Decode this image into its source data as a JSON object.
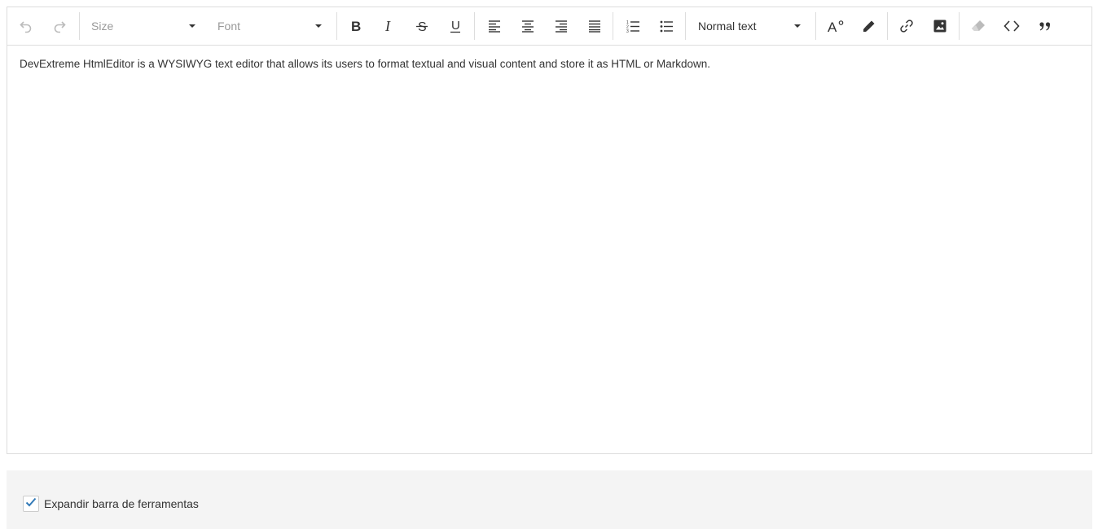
{
  "toolbar": {
    "undo_icon": "undo-icon",
    "redo_icon": "redo-icon",
    "size_placeholder": "Size",
    "font_placeholder": "Font",
    "bold_icon": "bold-icon",
    "italic_icon": "italic-icon",
    "strike_icon": "strikethrough-icon",
    "underline_icon": "underline-icon",
    "align_left_icon": "align-left-icon",
    "align_center_icon": "align-center-icon",
    "align_right_icon": "align-right-icon",
    "align_justify_icon": "align-justify-icon",
    "ordered_list_icon": "ordered-list-icon",
    "bullet_list_icon": "bullet-list-icon",
    "header_value": "Normal text",
    "color_icon": "font-color-icon",
    "background_icon": "background-color-icon",
    "link_icon": "link-icon",
    "image_icon": "image-icon",
    "clear_icon": "clear-format-icon",
    "codeblock_icon": "code-block-icon",
    "blockquote_icon": "blockquote-icon"
  },
  "editor": {
    "content": "DevExtreme HtmlEditor is a WYSIWYG text editor that allows its users to format textual and visual content and store it as HTML or Markdown."
  },
  "options": {
    "multiline_label": "Expandir barra de ferramentas",
    "multiline_checked": true
  },
  "colors": {
    "accent": "#337ab7",
    "border": "#dddddd",
    "panel_bg": "#f4f4f4",
    "disabled_icon": "#bbbbbb"
  }
}
